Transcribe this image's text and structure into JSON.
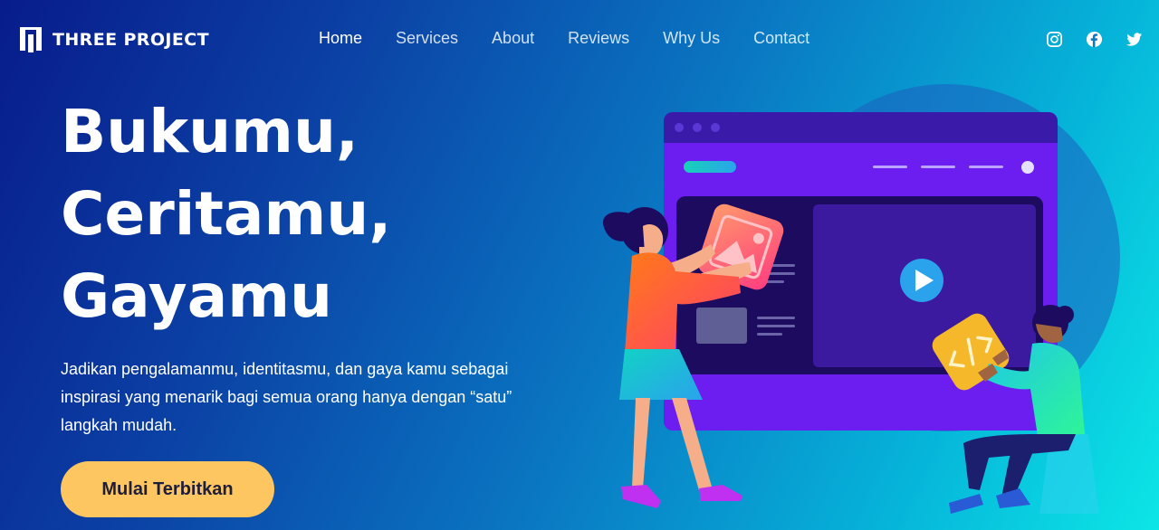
{
  "brand": {
    "name": "THREE PROJECT",
    "icon": "bars-logo-icon"
  },
  "nav": {
    "items": [
      {
        "label": "Home",
        "active": true
      },
      {
        "label": "Services",
        "active": false
      },
      {
        "label": "About",
        "active": false
      },
      {
        "label": "Reviews",
        "active": false
      },
      {
        "label": "Why Us",
        "active": false
      },
      {
        "label": "Contact",
        "active": false
      }
    ]
  },
  "social": [
    "instagram-icon",
    "facebook-icon",
    "twitter-icon"
  ],
  "hero": {
    "headline": [
      "Bukumu,",
      "Ceritamu,",
      "Gayamu"
    ],
    "subtitle": "Jadikan pengalamanmu, identitasmu, dan gaya kamu sebagai inspirasi yang menarik bagi semua orang hanya dengan “satu” langkah mudah.",
    "cta": "Mulai Terbitkan"
  },
  "colors": {
    "cta": "#fdc660",
    "browser_frame": "#6c1df0",
    "browser_header": "#3a1aa8",
    "play": "#2aa3ec",
    "code_tile": "#f5b82a",
    "image_tile": "#ff5e8a"
  }
}
